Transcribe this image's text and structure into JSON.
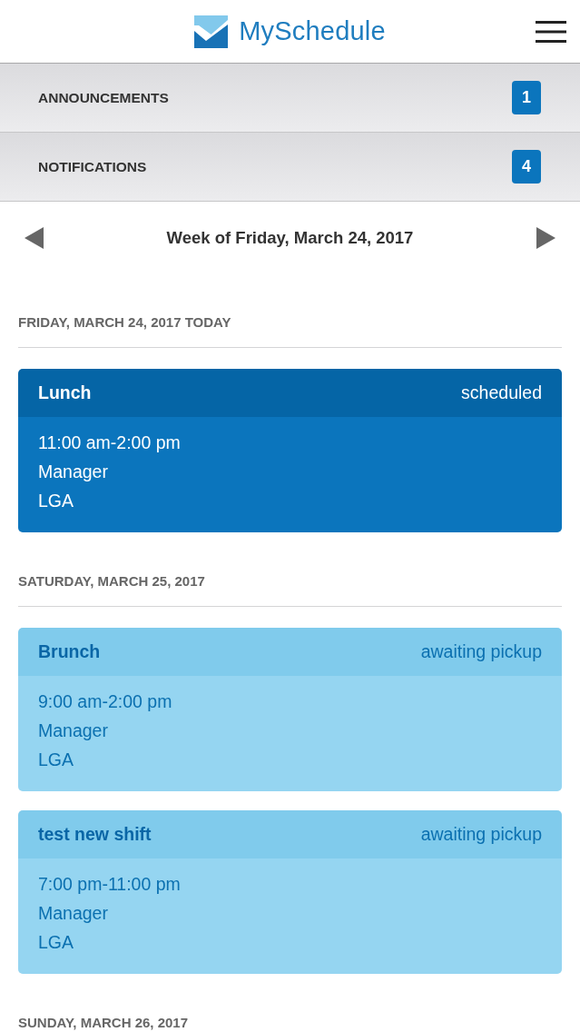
{
  "header": {
    "title": "MySchedule"
  },
  "panels": [
    {
      "label": "ANNOUNCEMENTS",
      "count": "1"
    },
    {
      "label": "NOTIFICATIONS",
      "count": "4"
    }
  ],
  "week_nav": {
    "label": "Week of Friday, March 24, 2017"
  },
  "days": [
    {
      "heading": "FRIDAY, MARCH 24, 2017 TODAY",
      "shifts": [
        {
          "kind": "scheduled",
          "title": "Lunch",
          "status": "scheduled",
          "time": "11:00 am-2:00 pm",
          "role": "Manager",
          "location": "LGA"
        }
      ]
    },
    {
      "heading": "SATURDAY, MARCH 25, 2017",
      "shifts": [
        {
          "kind": "awaiting",
          "title": "Brunch",
          "status": "awaiting pickup",
          "time": "9:00 am-2:00 pm",
          "role": "Manager",
          "location": "LGA"
        },
        {
          "kind": "awaiting",
          "title": "test new shift",
          "status": "awaiting pickup",
          "time": "7:00 pm-11:00 pm",
          "role": "Manager",
          "location": "LGA"
        }
      ]
    },
    {
      "heading": "SUNDAY, MARCH 26, 2017"
    }
  ]
}
